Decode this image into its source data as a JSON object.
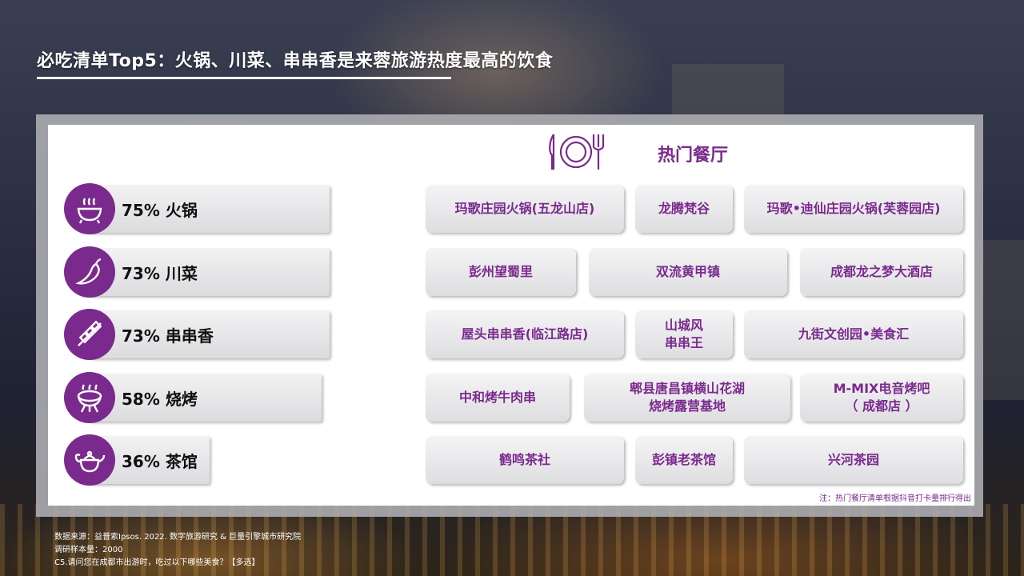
{
  "title": "必吃清单Top5：火锅、川菜、串串香是来蓉旅游热度最高的饮食",
  "colors": {
    "accent": "#7a2a8c",
    "tile": "#e6e6e8",
    "text": "#111111"
  },
  "chart_data": {
    "type": "bar",
    "categories": [
      "火锅",
      "川菜",
      "串串香",
      "烧烤",
      "茶馆"
    ],
    "values": [
      75,
      73,
      73,
      58,
      36
    ],
    "value_labels": [
      "75% 火锅",
      "73% 川菜",
      "73% 串串香",
      "58% 烧烤",
      "36% 茶馆"
    ],
    "icons": [
      "hotpot-icon",
      "chili-icon",
      "skewer-icon",
      "grill-icon",
      "teapot-icon"
    ],
    "xlim": [
      0,
      100
    ]
  },
  "restaurants": {
    "heading": "热门餐厅",
    "icon": "plate-cutlery-icon",
    "rows": [
      [
        "玛歌庄园火锅(五龙山店)",
        "龙腾梵谷",
        "玛歌•迪仙庄园火锅(芙蓉园店)"
      ],
      [
        "彭州望蜀里",
        "双流黄甲镇",
        "成都龙之梦大酒店"
      ],
      [
        "屋头串串香(临江路店)",
        "山城风\n串串王",
        "九街文创园•美食汇"
      ],
      [
        "中和烤牛肉串",
        "郫县唐昌镇横山花湖\n烧烤露营基地",
        "M-MIX电音烤吧\n（ 成都店 ）"
      ],
      [
        "鹤鸣茶社",
        "彭镇老茶馆",
        "兴河茶园"
      ]
    ],
    "note": "注：热门餐厅清单根据抖音打卡量排行得出"
  },
  "footer": {
    "source": "数据来源：益普索Ipsos. 2022. 数字旅游研究 & 巨量引擎城市研究院",
    "sample": "调研样本量：2000",
    "question": "C5.请问您在成都市出游时，吃过以下哪些美食？【多选】"
  }
}
